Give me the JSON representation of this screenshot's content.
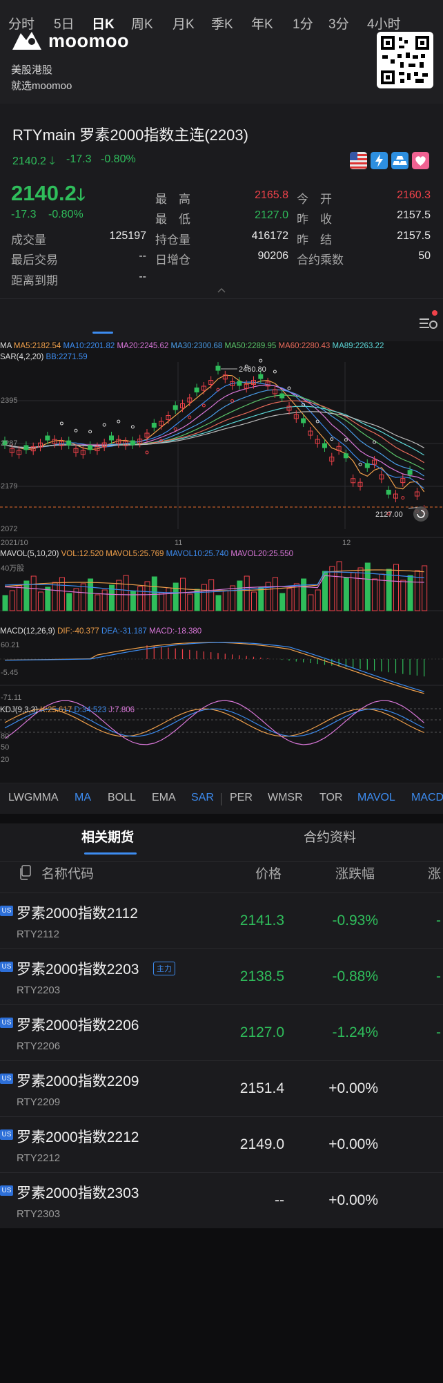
{
  "banner": {
    "brand": "moomoo",
    "line1": "美股港股",
    "line2": "就选moomoo"
  },
  "quote": {
    "title": "RTYmain   罗素2000指数主连(2203)",
    "sub_price": "2140.2",
    "sub_change": "-17.3",
    "sub_pct": "-0.80%",
    "price": "2140.2",
    "change": "-17.3",
    "pct": "-0.80%",
    "stats": {
      "high_label": "最　高",
      "high": "2165.8",
      "open_label": "今　开",
      "open": "2160.3",
      "low_label": "最　低",
      "low": "2127.0",
      "prevclose_label": "昨　收",
      "prevclose": "2157.5",
      "volume_label": "成交量",
      "volume": "125197",
      "oi_label": "持仓量",
      "oi": "416172",
      "settle_label": "昨　结",
      "settle": "2157.5",
      "lasttrade_label": "最后交易",
      "lasttrade": "--",
      "oichg_label": "日增仓",
      "oichg": "90206",
      "mult_label": "合约乘数",
      "mult": "50",
      "expiry_label": "距离到期",
      "expiry": "--"
    }
  },
  "tabs": [
    "分时",
    "5日",
    "日K",
    "周K",
    "月K",
    "季K",
    "年K",
    "1分",
    "3分",
    "4小时"
  ],
  "active_tab": "日K",
  "legends": {
    "ma_label": "MA",
    "ma5": "MA5:2182.54",
    "ma10": "MA10:2201.82",
    "ma20": "MA20:2245.62",
    "ma30": "MA30:2300.68",
    "ma50": "MA50:2289.95",
    "ma60": "MA60:2280.43",
    "ma89": "MA89:2263.22",
    "sar": "SAR(4,2,20)",
    "bb": "BB:2271.59",
    "mavol": "MAVOL(5,10,20)",
    "vol": "VOL:12.520",
    "mavol5": "MAVOL5:25.769",
    "mavol10": "MAVOL10:25.740",
    "mavol20": "MAVOL20:25.550",
    "vol_unit": "40万股",
    "macd": "MACD(12,26,9)",
    "dif": "DIF:-40.377",
    "dea": "DEA:-31.187",
    "macd_val": "MACD:-18.380",
    "kdj": "KDJ(9,3,3)",
    "k": "K:25.617",
    "d": "D:34.523",
    "j": "J:7.806"
  },
  "axis": {
    "y1": "2395",
    "y2": "2287",
    "y3": "2179",
    "y4": "2072",
    "high_mark": "2460.80",
    "low_mark": "2127.00",
    "x1": "2021/10",
    "x2": "11",
    "x3": "12",
    "macd_top": "60.21",
    "macd_mid": "-5.45",
    "macd_bot": "-71.11",
    "kdj80": "80",
    "kdj50": "50",
    "kdj20": "20"
  },
  "indicators": [
    "LWGMMA",
    "MA",
    "BOLL",
    "EMA",
    "SAR",
    "PER",
    "WMSR",
    "TOR",
    "MAVOL",
    "MACD"
  ],
  "subtabs": [
    "相关期货",
    "合约资料"
  ],
  "table": {
    "col_name": "名称代码",
    "col_price": "价格",
    "col_pct": "涨跌幅",
    "col_edge": "涨",
    "badge": "主力",
    "us": "US",
    "rows": [
      {
        "name": "罗素2000指数2112",
        "code": "RTY2112",
        "price": "2141.3",
        "pct": "-0.93%",
        "edge": "-"
      },
      {
        "name": "罗素2000指数2203",
        "code": "RTY2203",
        "price": "2138.5",
        "pct": "-0.88%",
        "edge": "-"
      },
      {
        "name": "罗素2000指数2206",
        "code": "RTY2206",
        "price": "2127.0",
        "pct": "-1.24%",
        "edge": "-"
      },
      {
        "name": "罗素2000指数2209",
        "code": "RTY2209",
        "price": "2151.4",
        "pct": "+0.00%",
        "edge": ""
      },
      {
        "name": "罗素2000指数2212",
        "code": "RTY2212",
        "price": "2149.0",
        "pct": "+0.00%",
        "edge": ""
      },
      {
        "name": "罗素2000指数2303",
        "code": "RTY2303",
        "price": "--",
        "pct": "+0.00%",
        "edge": ""
      }
    ]
  },
  "colors": {
    "up": "#f0424a",
    "down": "#2fbd5b",
    "accent": "#3d8cf0"
  }
}
